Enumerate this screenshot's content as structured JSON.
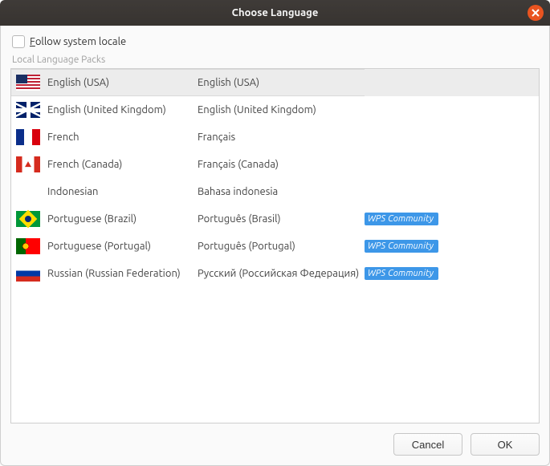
{
  "title": "Choose Language",
  "follow_locale": {
    "checked": false,
    "label_pre": "F",
    "label_post": "ollow system locale"
  },
  "section_title": "Local Language Packs",
  "badge_label": "WPS Community",
  "languages": [
    {
      "flag": "flag-usa",
      "name": "English (USA)",
      "native": "English (USA)",
      "community": false,
      "selected": true,
      "has_flag": true
    },
    {
      "flag": "flag-uk",
      "name": "English (United Kingdom)",
      "native": "English (United Kingdom)",
      "community": false,
      "selected": false,
      "has_flag": true
    },
    {
      "flag": "flag-fr",
      "name": "French",
      "native": "Français",
      "community": false,
      "selected": false,
      "has_flag": true
    },
    {
      "flag": "flag-ca",
      "name": "French (Canada)",
      "native": "Français (Canada)",
      "community": false,
      "selected": false,
      "has_flag": true
    },
    {
      "flag": "",
      "name": "Indonesian",
      "native": "Bahasa indonesia",
      "community": false,
      "selected": false,
      "has_flag": false
    },
    {
      "flag": "flag-br",
      "name": "Portuguese (Brazil)",
      "native": "Português (Brasil)",
      "community": true,
      "selected": false,
      "has_flag": true
    },
    {
      "flag": "flag-pt",
      "name": "Portuguese (Portugal)",
      "native": "Português (Portugal)",
      "community": true,
      "selected": false,
      "has_flag": true
    },
    {
      "flag": "flag-ru",
      "name": "Russian (Russian Federation)",
      "native": "Русский (Российская Федерация)",
      "community": true,
      "selected": false,
      "has_flag": true
    }
  ],
  "buttons": {
    "cancel": "Cancel",
    "ok": "OK"
  }
}
